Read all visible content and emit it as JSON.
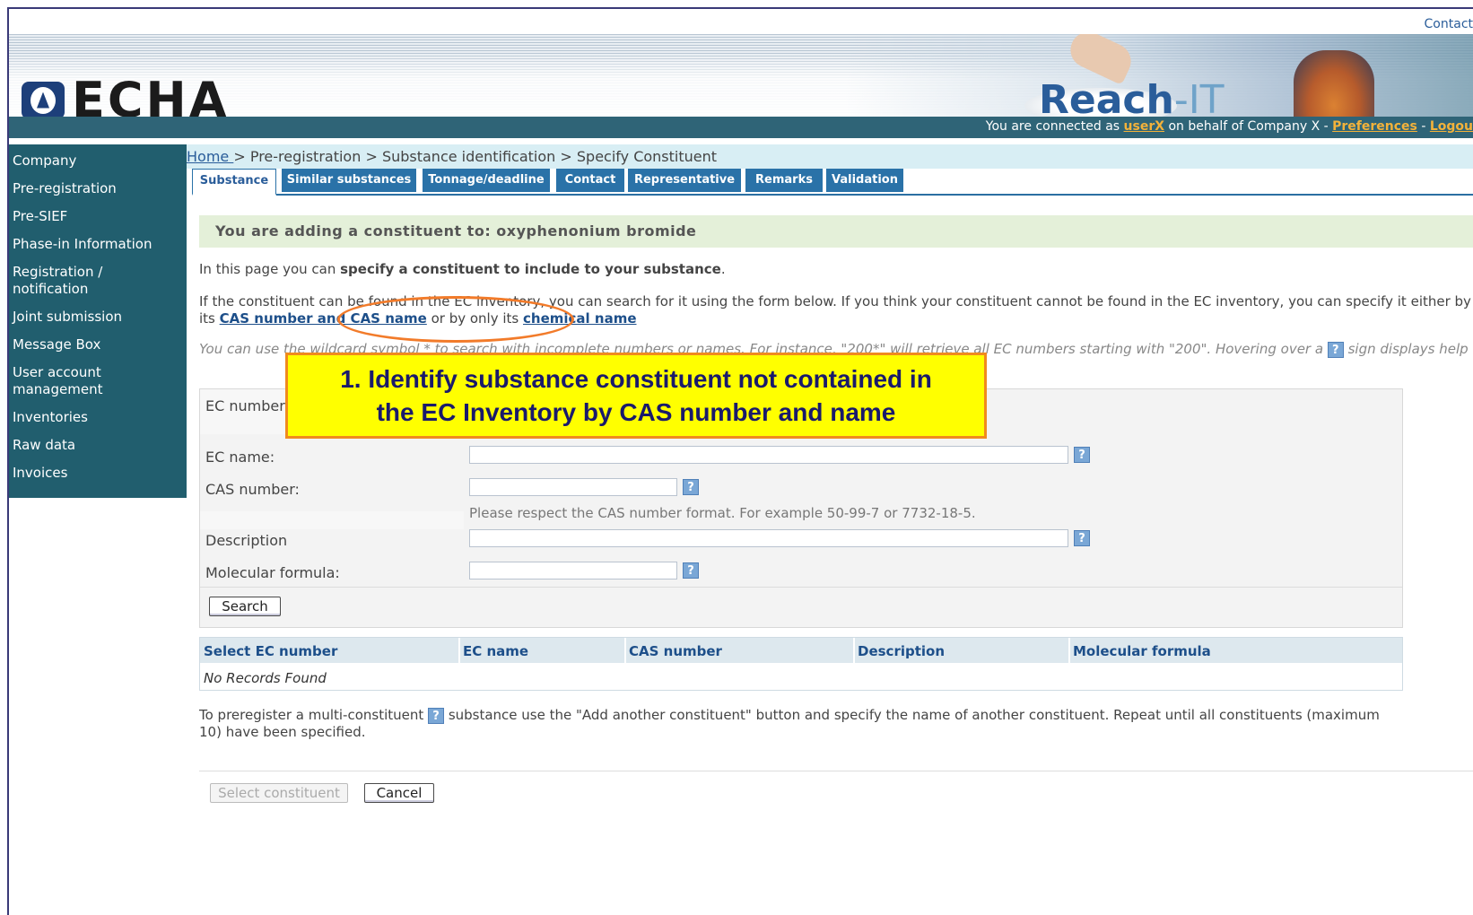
{
  "topbar": {
    "contact": "Contact"
  },
  "header": {
    "logo_text": "ECHA",
    "app_name_prefix": "Reach",
    "app_name_suffix": "-IT",
    "connected_prefix": "You are connected as ",
    "user": "userX",
    "connected_middle": " on behalf of Company X - ",
    "preferences": "Preferences",
    "separator": " - ",
    "logout": "Logou"
  },
  "sidebar": {
    "items": [
      {
        "label": "Company"
      },
      {
        "label": "Pre-registration"
      },
      {
        "label": "Pre-SIEF"
      },
      {
        "label": "Phase-in Information"
      },
      {
        "label": "Registration / notification"
      },
      {
        "label": "Joint submission"
      },
      {
        "label": "Message Box"
      },
      {
        "label": "User account management"
      },
      {
        "label": "Inventories"
      },
      {
        "label": "Raw data"
      },
      {
        "label": "Invoices"
      }
    ]
  },
  "breadcrumb": {
    "home": "Home ",
    "rest": "> Pre-registration > Substance identification > Specify Constituent"
  },
  "tabs": [
    {
      "label": "Substance"
    },
    {
      "label": "Similar substances"
    },
    {
      "label": "Tonnage/deadline"
    },
    {
      "label": "Contact"
    },
    {
      "label": "Representative"
    },
    {
      "label": "Remarks"
    },
    {
      "label": "Validation"
    }
  ],
  "banner": "You are adding a constituent to: oxyphenonium bromide",
  "intro": {
    "prefix": "In this page you can ",
    "bold": "specify a constituent to include to your substance",
    "suffix": "."
  },
  "search_help": {
    "text1": "If the constituent can be found in the EC inventory, you can search for it using the form below. If you think your constituent cannot be found in the EC inventory, you can specify it either by its ",
    "cas_link": "CAS number and CAS name",
    "text2": " or by only its ",
    "chem_link": "chemical name"
  },
  "wildcard_help": {
    "text1": "You can use the wildcard symbol * to search with incomplete numbers or names. For instance, \"200*\" will retrieve all EC numbers starting with \"200\". Hovering over a ",
    "qmark": "?",
    "text2": " sign displays help"
  },
  "form": {
    "ec_number_label": "EC number",
    "ec_name_label": "EC name:",
    "cas_number_label": "CAS number:",
    "cas_hint": "Please respect the CAS number format. For example 50-99-7 or 7732-18-5.",
    "description_label": "Description",
    "molecular_formula_label": "Molecular formula:",
    "qmark": "?",
    "search_button": "Search"
  },
  "results": {
    "columns": [
      "Select EC number",
      "EC name",
      "CAS number",
      "Description",
      "Molecular formula"
    ],
    "empty_text": "No Records Found"
  },
  "multi_constituent": {
    "text1": "To preregister a multi-constituent ",
    "qmark": "?",
    "text2": " substance use the \"Add another constituent\" button and specify the name of another constituent. Repeat until all constituents (maximum 10) have been specified."
  },
  "actions": {
    "select_constituent": "Select constituent",
    "cancel": "Cancel"
  },
  "annotation": {
    "line1": "1. Identify substance constituent not contained in",
    "line2": "the EC Inventory by CAS number and name"
  },
  "colors": {
    "sidebar_bg": "#215e6e",
    "tab_bg": "#2a72a8",
    "link": "#1d4f8a",
    "user_link": "#f3b23a",
    "annotation_bg": "#ffff00",
    "annotation_border": "#f08a1e"
  }
}
